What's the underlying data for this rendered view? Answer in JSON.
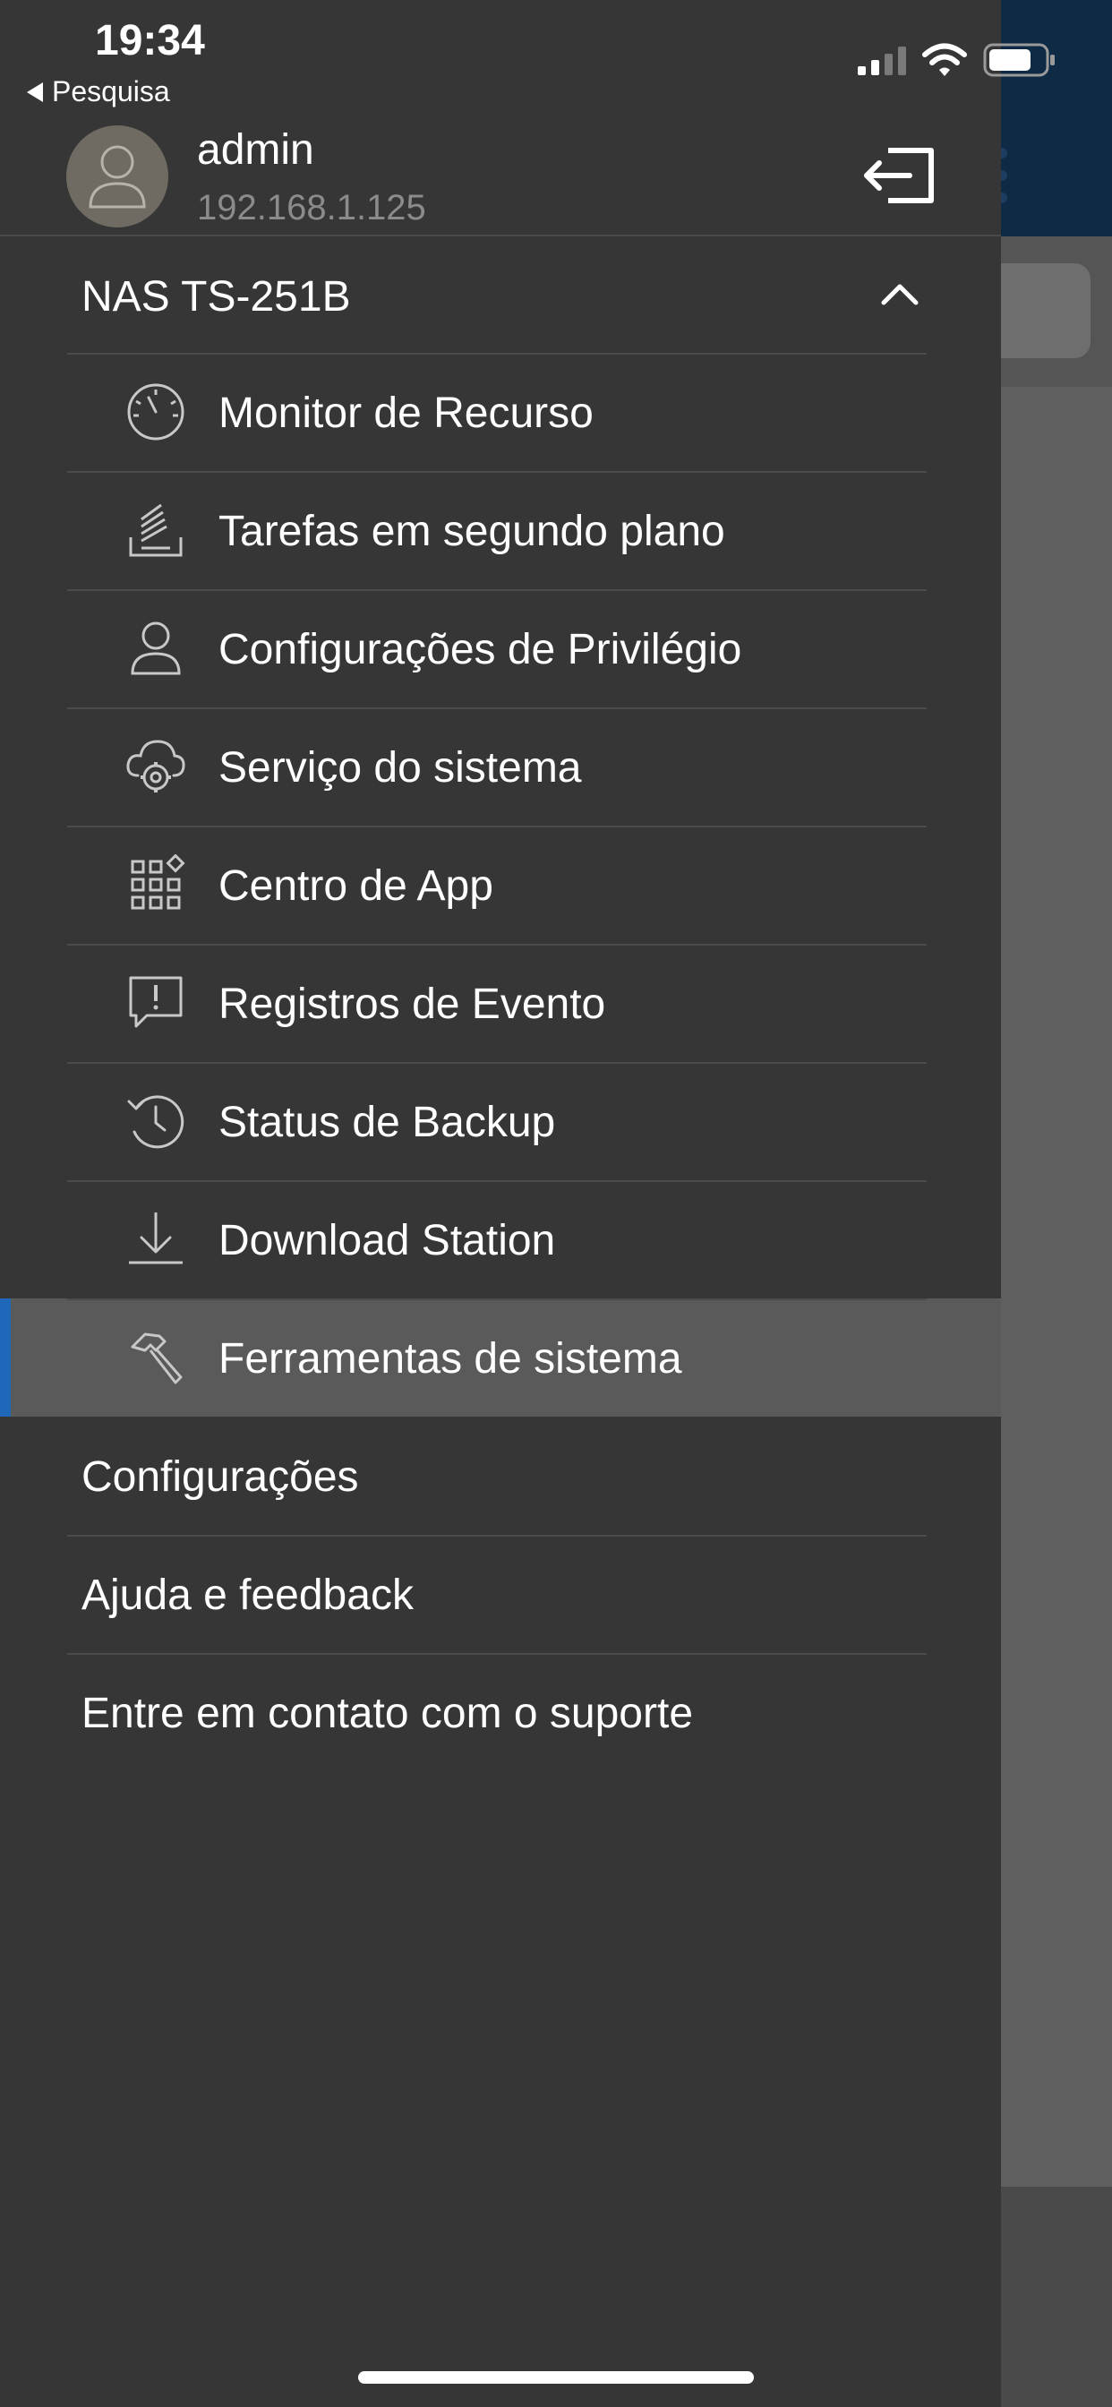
{
  "status_bar": {
    "time": "19:34",
    "back_label": "Pesquisa",
    "icons": [
      "cellular-signal-icon",
      "wifi-icon",
      "battery-icon"
    ]
  },
  "user": {
    "name": "admin",
    "ip": "192.168.1.125",
    "avatar_icon": "user-avatar-icon",
    "logout_icon": "logout-icon"
  },
  "device": {
    "name": "NAS TS-251B",
    "expand_icon": "chevron-up-icon"
  },
  "menu": {
    "items": [
      {
        "label": "Monitor de Recurso",
        "icon": "gauge-icon",
        "selected": false
      },
      {
        "label": "Tarefas em segundo plano",
        "icon": "tasks-icon",
        "selected": false
      },
      {
        "label": "Configurações de Privilégio",
        "icon": "user-icon",
        "selected": false
      },
      {
        "label": "Serviço do sistema",
        "icon": "cloud-gear-icon",
        "selected": false
      },
      {
        "label": "Centro de App",
        "icon": "app-grid-icon",
        "selected": false
      },
      {
        "label": "Registros de Evento",
        "icon": "alert-message-icon",
        "selected": false
      },
      {
        "label": "Status de Backup",
        "icon": "backup-clock-icon",
        "selected": false
      },
      {
        "label": "Download Station",
        "icon": "download-icon",
        "selected": false
      },
      {
        "label": "Ferramentas de sistema",
        "icon": "hammer-icon",
        "selected": true
      }
    ]
  },
  "bottom_menu": {
    "items": [
      {
        "label": "Configurações"
      },
      {
        "label": "Ajuda e feedback"
      },
      {
        "label": "Entre em contato com o suporte"
      }
    ]
  },
  "colors": {
    "drawer_bg": "#363636",
    "selected_bg": "#5a5a5a",
    "selected_accent": "#1f67b8",
    "background_header": "#0f2a45",
    "secondary_text": "#8b8b8b"
  }
}
